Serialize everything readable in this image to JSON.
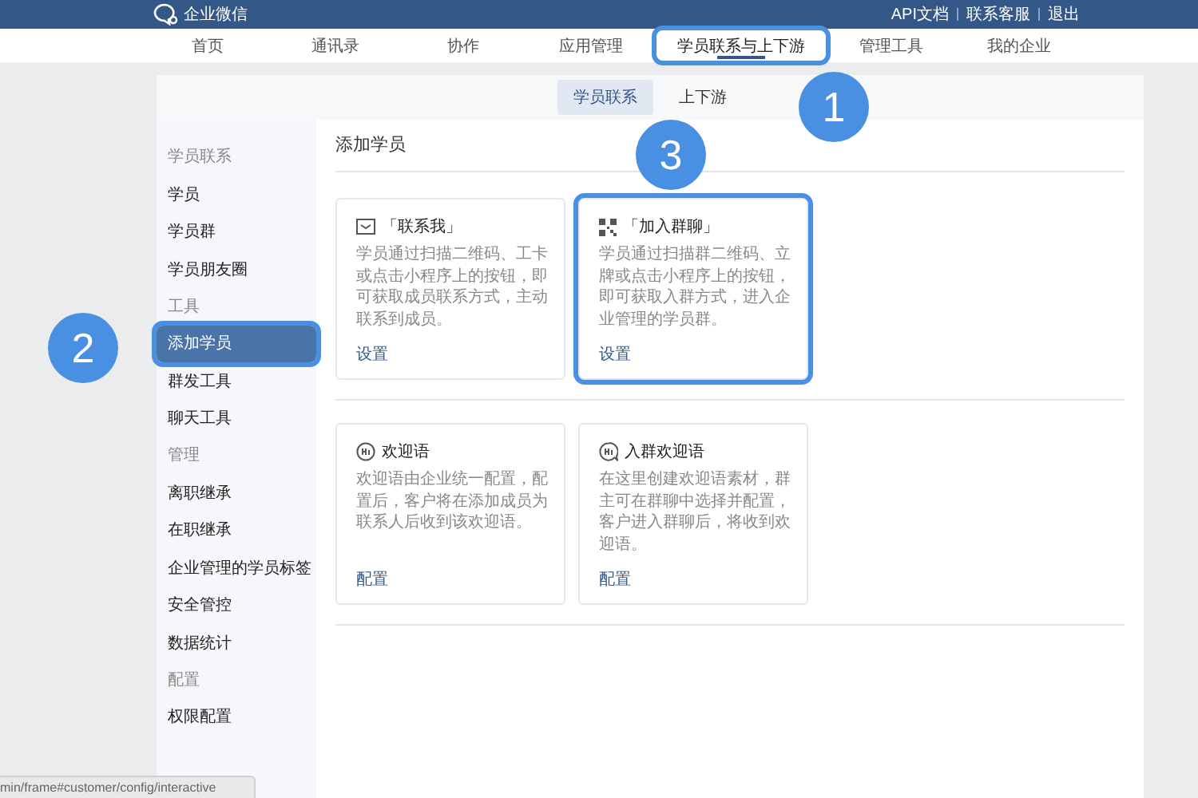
{
  "top_bar": {
    "logo_text": "企业微信",
    "links": [
      "API文档",
      "联系客服",
      "退出"
    ]
  },
  "nav": [
    {
      "label": "首页",
      "selected": false,
      "highlighted": false
    },
    {
      "label": "通讯录",
      "selected": false,
      "highlighted": false
    },
    {
      "label": "协作",
      "selected": false,
      "highlighted": false
    },
    {
      "label": "应用管理",
      "selected": false,
      "highlighted": false
    },
    {
      "label": "学员联系与上下游",
      "selected": true,
      "highlighted": true
    },
    {
      "label": "管理工具",
      "selected": false,
      "highlighted": false
    },
    {
      "label": "我的企业",
      "selected": false,
      "highlighted": false
    }
  ],
  "subtabs": [
    {
      "label": "学员联系",
      "selected": true
    },
    {
      "label": "上下游",
      "selected": false
    }
  ],
  "sidebar": [
    {
      "heading": "学员联系",
      "items": [
        {
          "label": "学员",
          "selected": false,
          "highlighted": false
        },
        {
          "label": "学员群",
          "selected": false,
          "highlighted": false
        },
        {
          "label": "学员朋友圈",
          "selected": false,
          "highlighted": false
        }
      ]
    },
    {
      "heading": "工具",
      "items": [
        {
          "label": "添加学员",
          "selected": true,
          "highlighted": true
        },
        {
          "label": "群发工具",
          "selected": false,
          "highlighted": false
        },
        {
          "label": "聊天工具",
          "selected": false,
          "highlighted": false
        }
      ]
    },
    {
      "heading": "管理",
      "items": [
        {
          "label": "离职继承",
          "selected": false,
          "highlighted": false
        },
        {
          "label": "在职继承",
          "selected": false,
          "highlighted": false
        },
        {
          "label": "企业管理的学员标签",
          "selected": false,
          "highlighted": false
        },
        {
          "label": "安全管控",
          "selected": false,
          "highlighted": false
        },
        {
          "label": "数据统计",
          "selected": false,
          "highlighted": false
        }
      ]
    },
    {
      "heading": "配置",
      "items": [
        {
          "label": "权限配置",
          "selected": false,
          "highlighted": false
        }
      ]
    }
  ],
  "content": {
    "title": "添加学员",
    "sections": [
      {
        "cards": [
          {
            "kind": "message",
            "title": "「联系我」",
            "description": "学员通过扫描二维码、工卡或点击小程序上的按钮，即可获取成员联系方式，主动联系到成员。",
            "action": "设置",
            "highlighted": false
          },
          {
            "kind": "qrcode",
            "title": "「加入群聊」",
            "description": "学员通过扫描群二维码、立牌或点击小程序上的按钮，即可获取入群方式，进入企业管理的学员群。",
            "action": "设置",
            "highlighted": true
          }
        ]
      },
      {
        "cards": [
          {
            "kind": "hi",
            "title": "欢迎语",
            "description": "欢迎语由企业统一配置，配置后，客户将在添加成员为联系人后收到该欢迎语。",
            "action": "配置",
            "highlighted": false
          },
          {
            "kind": "hi-chat",
            "title": "入群欢迎语",
            "description": "在这里创建欢迎语素材，群主可在群聊中选择并配置，客户进入群聊后，将收到欢迎语。",
            "action": "配置",
            "highlighted": false
          }
        ]
      }
    ]
  },
  "callouts": [
    "1",
    "2",
    "3"
  ],
  "status_url": "min/frame#customer/config/interactive"
}
